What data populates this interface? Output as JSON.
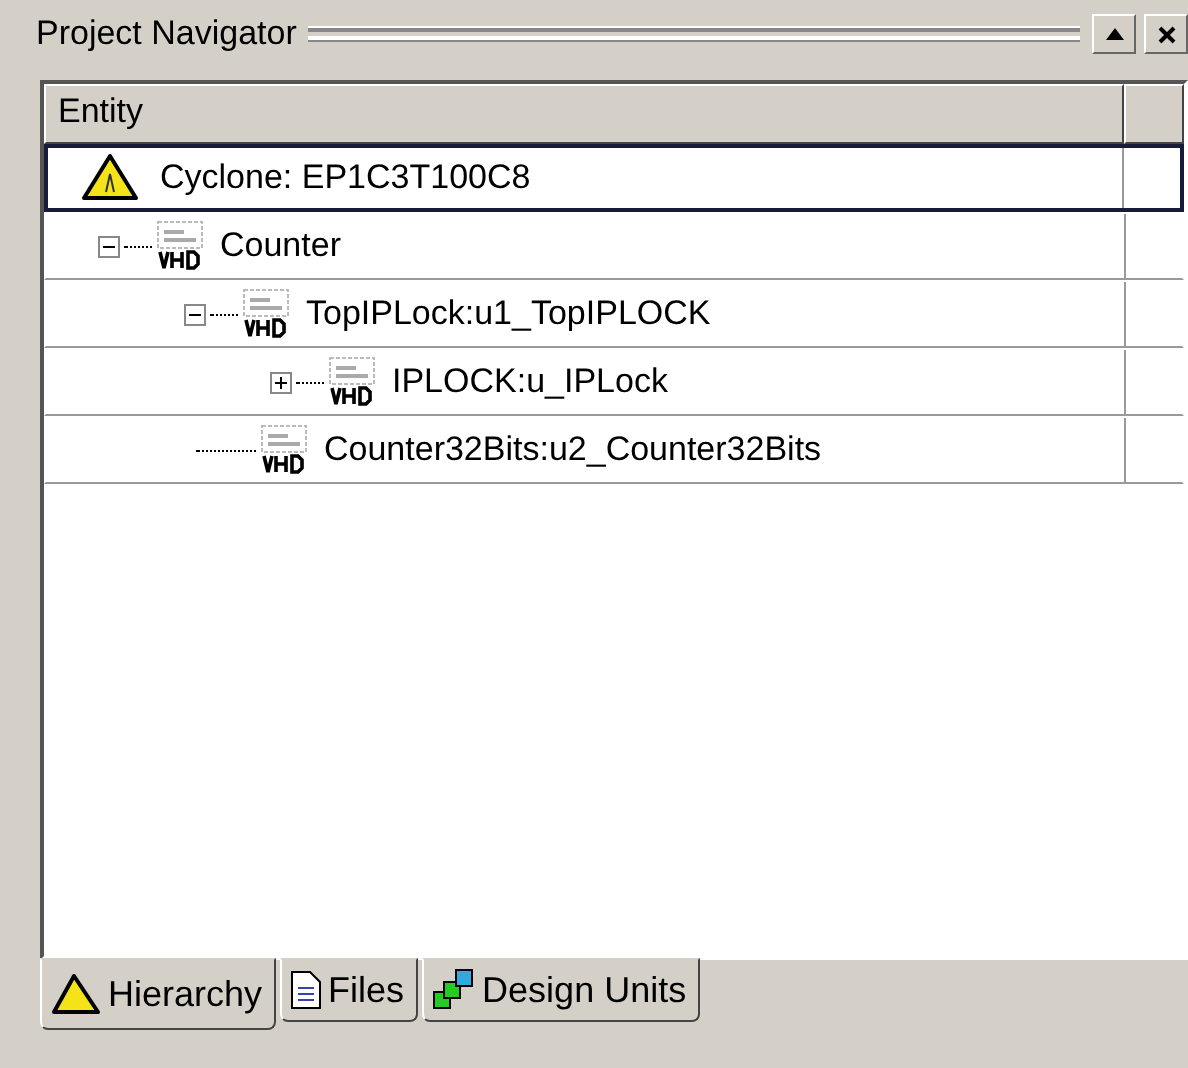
{
  "panel": {
    "title": "Project Navigator"
  },
  "table": {
    "columns": [
      "Entity"
    ],
    "tree": [
      {
        "kind": "device",
        "label": "Cyclone: EP1C3T100C8",
        "selected": true,
        "children": [
          {
            "kind": "vhdl",
            "label": "Counter",
            "selected": false,
            "expanded": true,
            "children": [
              {
                "kind": "vhdl",
                "label": "TopIPLock:u1_TopIPLOCK",
                "selected": false,
                "expanded": true,
                "children": [
                  {
                    "kind": "vhdl",
                    "label": "IPLOCK:u_IPLock",
                    "selected": false,
                    "expanded": false
                  }
                ]
              },
              {
                "kind": "vhdl",
                "label": "Counter32Bits:u2_Counter32Bits",
                "selected": false
              }
            ]
          }
        ]
      }
    ]
  },
  "tabs": [
    {
      "kind": "hierarchy",
      "label": "Hierarchy",
      "selected": true
    },
    {
      "kind": "files",
      "label": "Files",
      "selected": false
    },
    {
      "kind": "units",
      "label": "Design Units",
      "selected": false
    }
  ]
}
